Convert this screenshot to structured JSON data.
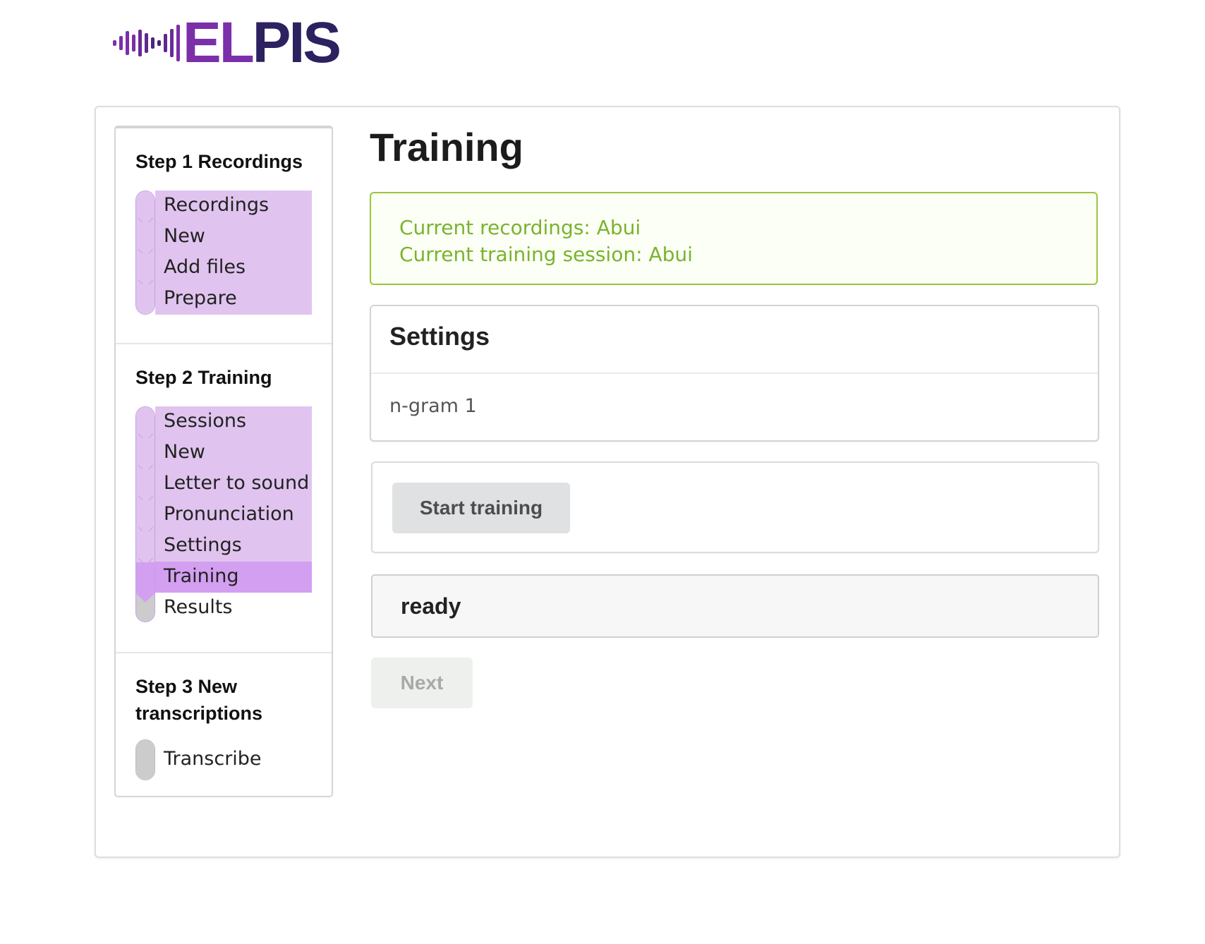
{
  "logo": {
    "text_a": "EL",
    "text_b": "PIS"
  },
  "steps": [
    {
      "title": "Step 1 Recordings",
      "items": [
        {
          "label": "Recordings",
          "state": "done"
        },
        {
          "label": "New",
          "state": "done"
        },
        {
          "label": "Add files",
          "state": "done"
        },
        {
          "label": "Prepare",
          "state": "done"
        }
      ]
    },
    {
      "title": "Step 2 Training",
      "items": [
        {
          "label": "Sessions",
          "state": "done"
        },
        {
          "label": "New",
          "state": "done"
        },
        {
          "label": "Letter to sound",
          "state": "done"
        },
        {
          "label": "Pronunciation",
          "state": "done"
        },
        {
          "label": "Settings",
          "state": "done"
        },
        {
          "label": "Training",
          "state": "active"
        },
        {
          "label": "Results",
          "state": "todo"
        }
      ]
    },
    {
      "title": "Step 3 New transcriptions",
      "items": [
        {
          "label": "Transcribe",
          "state": "todo"
        }
      ]
    }
  ],
  "main": {
    "title": "Training",
    "notice": {
      "line1": "Current recordings: Abui",
      "line2": "Current training session: Abui"
    },
    "settings": {
      "header": "Settings",
      "value": "n-gram 1"
    },
    "start_button": "Start training",
    "status": "ready",
    "next_button": "Next"
  },
  "colors": {
    "step_done": "#e0c4ef",
    "step_active": "#d39ff0",
    "step_todo": "#cccccc",
    "notice_text": "#7ab32e",
    "notice_border": "#9bc53d",
    "logo_purple": "#7b2fa8",
    "logo_navy": "#2d2160"
  }
}
